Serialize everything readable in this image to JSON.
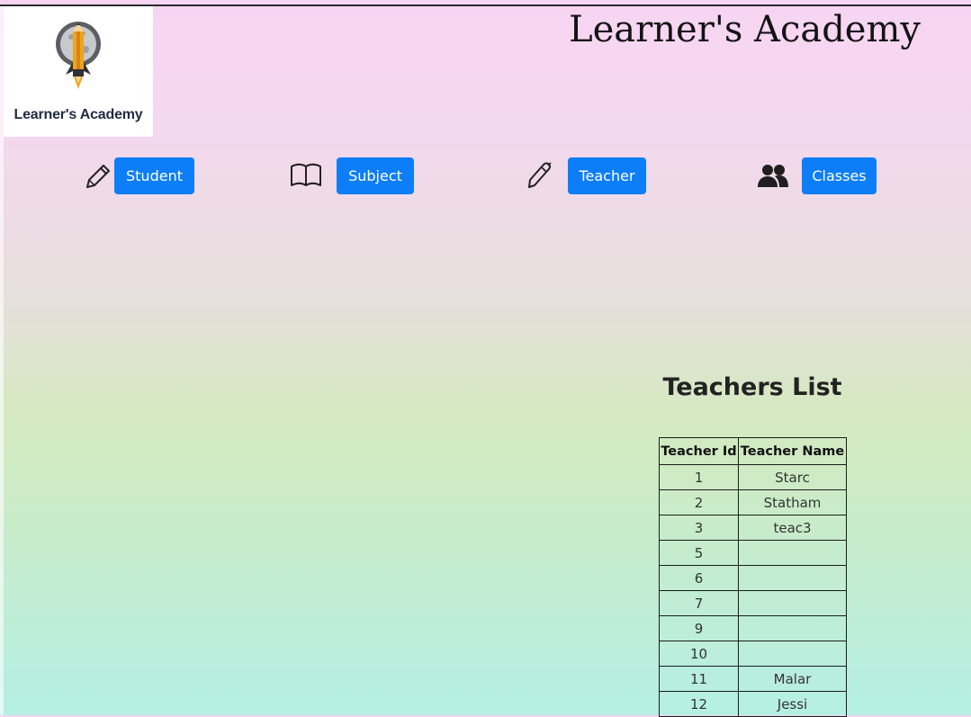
{
  "brand": {
    "logo_text": "Learner's Academy",
    "title": "Learner's Academy"
  },
  "nav": {
    "items": [
      {
        "label": "Student",
        "icon": "pencil-icon"
      },
      {
        "label": "Subject",
        "icon": "book-icon"
      },
      {
        "label": "Teacher",
        "icon": "pen-icon"
      },
      {
        "label": "Classes",
        "icon": "people-icon"
      }
    ]
  },
  "teachers": {
    "title": "Teachers List",
    "headers": [
      "Teacher Id",
      "Teacher Name"
    ],
    "rows": [
      {
        "id": "1",
        "name": "Starc"
      },
      {
        "id": "2",
        "name": "Statham"
      },
      {
        "id": "3",
        "name": "teac3"
      },
      {
        "id": "5",
        "name": ""
      },
      {
        "id": "6",
        "name": ""
      },
      {
        "id": "7",
        "name": ""
      },
      {
        "id": "9",
        "name": ""
      },
      {
        "id": "10",
        "name": ""
      },
      {
        "id": "11",
        "name": "Malar"
      },
      {
        "id": "12",
        "name": "Jessi"
      }
    ]
  },
  "colors": {
    "button_bg": "#0d7ef7",
    "button_text": "#ffffff"
  }
}
